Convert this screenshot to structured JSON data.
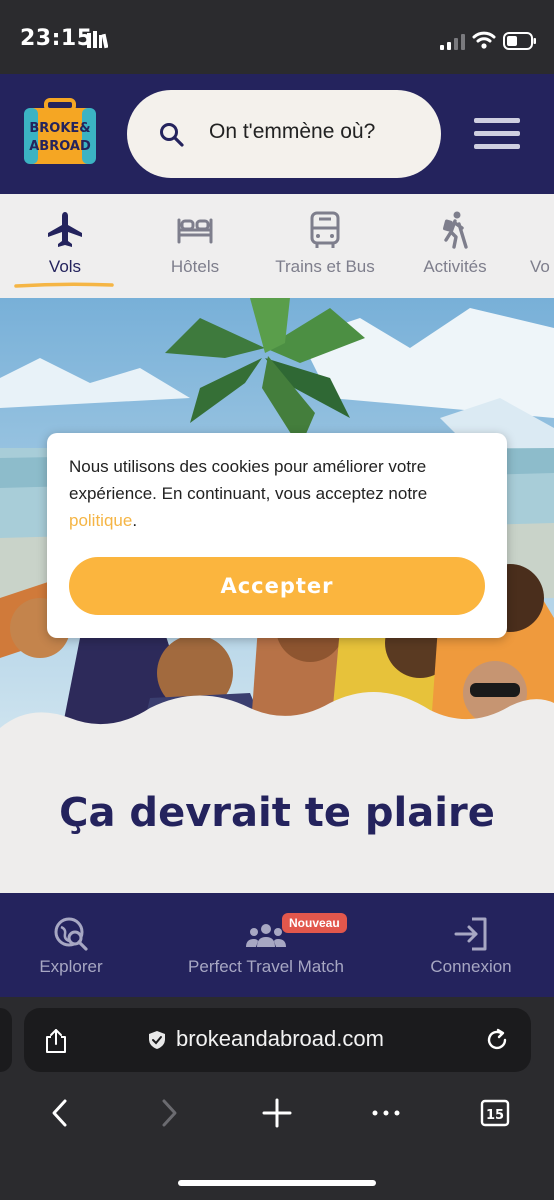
{
  "status_bar": {
    "time": "23:15"
  },
  "header": {
    "logo_text_line1": "BROKE&",
    "logo_text_line2": "ABROAD",
    "search_placeholder": "On t'emmène où?"
  },
  "category_tabs": [
    {
      "label": "Vols",
      "icon": "plane-icon",
      "active": true
    },
    {
      "label": "Hôtels",
      "icon": "bed-icon",
      "active": false
    },
    {
      "label": "Trains et Bus",
      "icon": "bus-icon",
      "active": false
    },
    {
      "label": "Activités",
      "icon": "hiker-icon",
      "active": false
    },
    {
      "label": "Vo",
      "icon": "",
      "active": false
    }
  ],
  "cookie": {
    "text_before_link": "Nous utilisons des cookies pour améliorer votre expérience. En continuant, vous acceptez notre ",
    "link_text": "politique",
    "text_after_link": ".",
    "accept_label": "Accepter"
  },
  "section": {
    "title": "Ça devrait te plaire"
  },
  "site_nav": [
    {
      "label": "Explorer",
      "icon": "explore-icon"
    },
    {
      "label": "Perfect Travel Match",
      "icon": "group-icon",
      "badge": "Nouveau"
    },
    {
      "label": "Connexion",
      "icon": "login-icon"
    }
  ],
  "browser": {
    "url": "brokeandabroad.com",
    "tab_count": "15"
  },
  "colors": {
    "brand_navy": "#24235d",
    "accent_orange": "#fbb53e",
    "badge_red": "#e2574c"
  }
}
